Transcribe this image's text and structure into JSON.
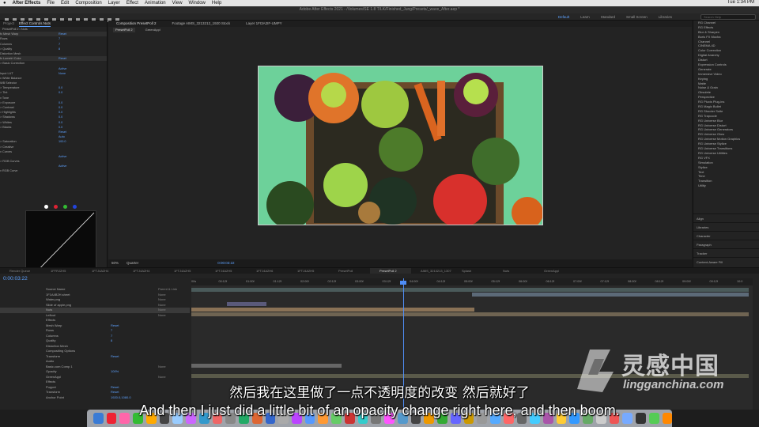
{
  "menubar": {
    "apple": "",
    "items": [
      "After Effects",
      "File",
      "Edit",
      "Composition",
      "Layer",
      "Effect",
      "Animation",
      "View",
      "Window",
      "Help"
    ],
    "clock": "Tue 1:34 PM"
  },
  "titlebar": {
    "text": "Adobe After Effects 2021 - /Volumes/SE 1.8 T/LK/Finished_Jung/Presets/_wave_After.aep *"
  },
  "workspaces": [
    "Default",
    "Learn",
    "Standard",
    "Small Screen",
    "Libraries"
  ],
  "search_placeholder": "Search Help",
  "left_panel": {
    "tabs": [
      "Project",
      "Effect Controls Nuts"
    ],
    "header": "PresetPoll 2 • Nuts",
    "rows": [
      {
        "label": "fx  Mesh Warp",
        "value": "Reset"
      },
      {
        "label": "    Rows",
        "value": "7"
      },
      {
        "label": "    Columns",
        "value": "7"
      },
      {
        "label": "  > Quality",
        "value": "8"
      },
      {
        "label": "    Distortion Mesh",
        "value": ""
      },
      {
        "label": "fx  Lumetri Color",
        "value": "Reset"
      },
      {
        "label": "  > Basic Correction",
        "value": ""
      },
      {
        "label": "",
        "value": "Active"
      },
      {
        "label": "    Input LUT",
        "value": "None"
      },
      {
        "label": "  v White Balance",
        "value": ""
      },
      {
        "label": "      WB Selector",
        "value": ""
      },
      {
        "label": "    > Temperature",
        "value": "0.0"
      },
      {
        "label": "    > Tint",
        "value": "0.0"
      },
      {
        "label": "  v Tone",
        "value": ""
      },
      {
        "label": "    > Exposure",
        "value": "0.0"
      },
      {
        "label": "    > Contrast",
        "value": "0.0"
      },
      {
        "label": "    > Highlights",
        "value": "0.0"
      },
      {
        "label": "    > Shadows",
        "value": "0.0"
      },
      {
        "label": "    > Whites",
        "value": "0.0"
      },
      {
        "label": "    > Blacks",
        "value": "0.0"
      },
      {
        "label": "",
        "value": "Reset"
      },
      {
        "label": "",
        "value": "Auto"
      },
      {
        "label": "  > Saturation",
        "value": "100.0"
      },
      {
        "label": "  > Creative",
        "value": ""
      },
      {
        "label": "  v Curves",
        "value": ""
      },
      {
        "label": "",
        "value": "Active"
      },
      {
        "label": "    > RGB Curves",
        "value": ""
      },
      {
        "label": "",
        "value": "Active"
      },
      {
        "label": "    v RGB Curve",
        "value": ""
      }
    ]
  },
  "viewer": {
    "tabs": [
      "Composition PresetPoll 2",
      "Footage AIMS_3213212_1920 Stock",
      "Layer 1FI3A2IF-UMPY"
    ],
    "subtabs": [
      "PresetPoll 2",
      "GreenAppl"
    ],
    "footer": [
      "50%",
      "Quarter",
      "0:00:03:22"
    ]
  },
  "right_panel": {
    "effects": [
      "RG Channel",
      "RG Effects",
      "Blur & Sharpen",
      "Boris FX Mocha",
      "Channel",
      "CINEMA 4D",
      "Color Correction",
      "Digital Anarchy",
      "Distort",
      "Expression Controls",
      "Generate",
      "Immersive Video",
      "Keying",
      "Matte",
      "Noise & Grain",
      "Obsolete",
      "Perspective",
      "RG Pluxis Plug-ins",
      "RG Magic Bullet",
      "RG Shooter Suite",
      "RG Trapcode",
      "RG Universe Blur",
      "RG Universe Distort",
      "RG Universe Generators",
      "RG Universe Glow",
      "RG Universe Motion Graphics",
      "RG Universe Stylize",
      "RG Universe Transitions",
      "RG Universe Utilities",
      "RG VFX",
      "Simulation",
      "Stylize",
      "Text",
      "Time",
      "Transition",
      "Utility"
    ],
    "sections": [
      "Align",
      "Libraries",
      "Character",
      "Paragraph",
      "Tracker",
      "Content-Aware Fill"
    ]
  },
  "timeline": {
    "tabs": [
      "Render Queue",
      "1FFRJ2H5",
      "1FTJ4A2H4",
      "1FTJ4A2H4",
      "1FTJ4A2H5",
      "1FTJ4A2H5",
      "1FTJ4A2H6",
      "1FTJ4A2H5",
      "PresetPoll",
      "PresetPoll 2",
      "AIMS_3213213_1307",
      "Splash",
      "Nuts",
      "GreenAppl"
    ],
    "timecode": "0:00:03:22",
    "ruler": [
      "00s",
      "00:12f",
      "01:00f",
      "01:12f",
      "02:00f",
      "02:12f",
      "03:00f",
      "03:12f",
      "04:00f",
      "04:12f",
      "05:00f",
      "05:12f",
      "06:00f",
      "06:12f",
      "07:00f",
      "07:12f",
      "08:00f",
      "08:12f",
      "09:00f",
      "09:12f",
      "10:0"
    ],
    "layers": [
      {
        "name": "Source Name",
        "prop": "",
        "mode": "Parent & Link",
        "sel": false
      },
      {
        "name": "1F1A4B2H.sheet",
        "prop": "",
        "mode": "None",
        "sel": false
      },
      {
        "name": "Water.png",
        "prop": "",
        "mode": "None",
        "sel": false
      },
      {
        "name": "Slide of apple.png",
        "prop": "",
        "mode": "None",
        "sel": false
      },
      {
        "name": "Nuts",
        "prop": "",
        "mode": "None",
        "sel": true
      },
      {
        "name": "Leftout",
        "prop": "",
        "mode": "None",
        "sel": false
      },
      {
        "name": "Effects",
        "prop": "",
        "mode": "",
        "sel": false
      },
      {
        "name": "  Mesh Warp",
        "prop": "Reset",
        "mode": "",
        "sel": false
      },
      {
        "name": "    Rows",
        "prop": "7",
        "mode": "",
        "sel": false
      },
      {
        "name": "    Columns",
        "prop": "7",
        "mode": "",
        "sel": false
      },
      {
        "name": "    Quality",
        "prop": "8",
        "mode": "",
        "sel": false
      },
      {
        "name": "    Distortion Mesh",
        "prop": "",
        "mode": "",
        "sel": false
      },
      {
        "name": "  Compositing Options",
        "prop": "",
        "mode": "",
        "sel": false
      },
      {
        "name": "Transform",
        "prop": "Reset",
        "mode": "",
        "sel": false
      },
      {
        "name": "Audio",
        "prop": "",
        "mode": "",
        "sel": false
      },
      {
        "name": "Basic.com Comp 1",
        "prop": "",
        "mode": "None",
        "sel": false
      },
      {
        "name": "  Opacity",
        "prop": "100%",
        "mode": "",
        "sel": false
      },
      {
        "name": "GreenAppl",
        "prop": "",
        "mode": "None",
        "sel": false
      },
      {
        "name": "Effects",
        "prop": "",
        "mode": "",
        "sel": false
      },
      {
        "name": "  Puppet",
        "prop": "Reset",
        "mode": "",
        "sel": false
      },
      {
        "name": "Transform",
        "prop": "Reset",
        "mode": "",
        "sel": false
      },
      {
        "name": "  Anchor Point",
        "prop": "1920.0,1080.0",
        "mode": "",
        "sel": false
      }
    ]
  },
  "subtitles": {
    "chinese": "然后我在这里做了一点不透明度的改变 然后就好了",
    "english": "And then I just did a little bit of an opacity change right here, and then boom."
  },
  "watermark": {
    "chinese": "灵感中国",
    "english": "lingganchina.com"
  },
  "colors": {
    "accent": "#5ea2ff",
    "stage_bg": "#6dd19a"
  }
}
